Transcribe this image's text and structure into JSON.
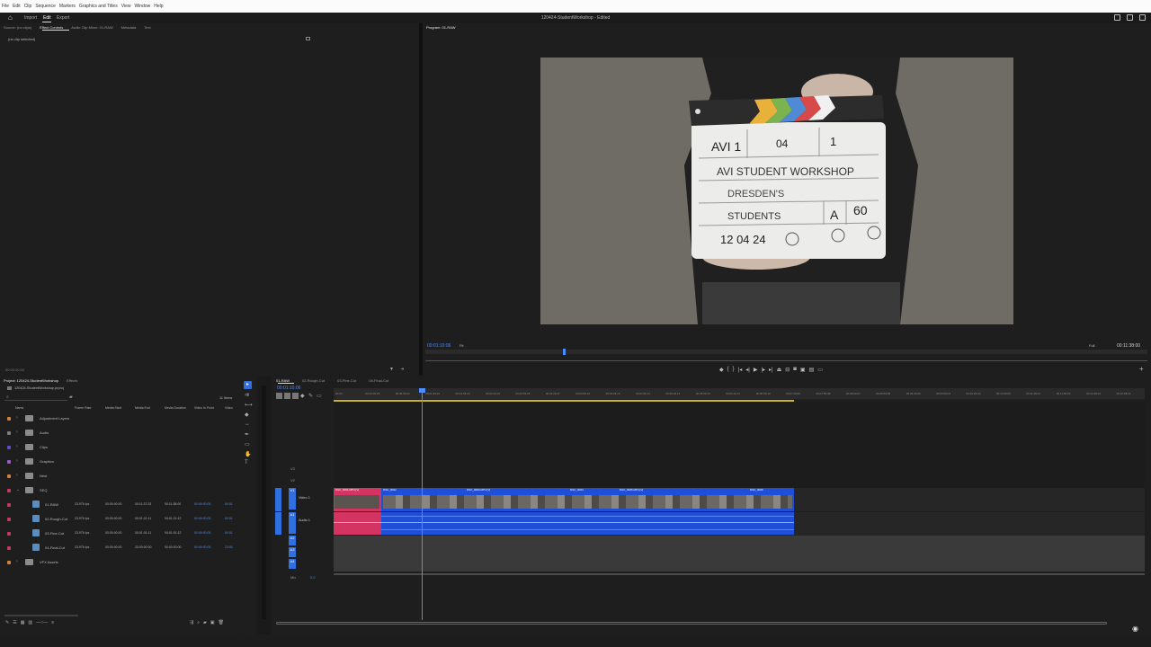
{
  "menu": [
    "File",
    "Edit",
    "Clip",
    "Sequence",
    "Markers",
    "Graphics and Titles",
    "View",
    "Window",
    "Help"
  ],
  "workspace": {
    "tabs": [
      "Import",
      "Edit",
      "Export"
    ],
    "active_tab": "Edit",
    "doc_title": "120424-StudentWorkshop - Edited"
  },
  "source_panel": {
    "tabs": [
      "Source: (no clips)",
      "Effect Controls",
      "Audio Clip Mixer: 01-RAW",
      "Metadata",
      "Text"
    ],
    "active_tab": "Effect Controls",
    "no_clip": "(no clip selected)",
    "timecode": "00:00:00:00"
  },
  "program_panel": {
    "tab": "Program: 01-RAW",
    "timecode": "00:01:10:06",
    "zoom": "Fit",
    "quality": "Full",
    "duration": "00:11:38:00"
  },
  "slate": {
    "roll": "AVI 1",
    "scene": "04",
    "take": "1",
    "production": "AVI STUDENT WORKSHOP",
    "director": "DRESDEN'S",
    "camera": "STUDENTS",
    "cam_letter": "A",
    "fps": "60",
    "date": "12 04 24"
  },
  "project_panel": {
    "tabs": [
      "Project: 120424-StudentWorkshop",
      "Effects"
    ],
    "file": "120424-StudentWorkshop.prproj",
    "item_count": "11 Items",
    "columns": [
      "Name",
      "Frame Rate",
      "Media Start",
      "Media End",
      "Media Duration",
      "Video In Point",
      "Video"
    ],
    "items": [
      {
        "name": "Adjustment Layers",
        "type": "folder",
        "color": "#d1813a",
        "expanded": false
      },
      {
        "name": "Audio",
        "type": "folder",
        "color": "#7d7d7d",
        "expanded": false
      },
      {
        "name": "Clips",
        "type": "folder",
        "color": "#5a4fd1",
        "expanded": false
      },
      {
        "name": "Graphics",
        "type": "folder",
        "color": "#9b5bc9",
        "expanded": false
      },
      {
        "name": "Nest",
        "type": "folder",
        "color": "#d1813a",
        "expanded": false
      },
      {
        "name": "SEQ",
        "type": "folder",
        "color": "#c43a5a",
        "expanded": true
      },
      {
        "name": "01-RAW",
        "type": "seq",
        "color": "#c43a5a",
        "fps": "23.976 fps",
        "start": "00:00:00:00",
        "end": "00:11:37:23",
        "dur": "00:11:38:00",
        "in": "00:00:00:00",
        "v": "00:01"
      },
      {
        "name": "02-Rough-Cut",
        "type": "seq",
        "color": "#c43a5a",
        "fps": "23.976 fps",
        "start": "00:00:00:00",
        "end": "00:01:21:11",
        "dur": "00:01:21:12",
        "in": "00:00:00:00",
        "v": "00:01"
      },
      {
        "name": "03-Fine-Cut",
        "type": "seq",
        "color": "#c43a5a",
        "fps": "23.976 fps",
        "start": "00:00:00:00",
        "end": "00:01:01:11",
        "dur": "00:01:01:12",
        "in": "00:00:00:00",
        "v": "00:01"
      },
      {
        "name": "04-Final-Cut",
        "type": "seq",
        "color": "#c43a5a",
        "fps": "23.976 fps",
        "start": "00:00:00:00",
        "end": "23:00:00:00",
        "dur": "00:00:00:00",
        "in": "00:00:00:00",
        "v": "23:00"
      },
      {
        "name": "VFX Assets",
        "type": "folder",
        "color": "#d1813a",
        "expanded": false
      }
    ]
  },
  "timeline": {
    "tabs": [
      "01-RAW",
      "02-Rough-Cut",
      "03-Fine-Cut",
      "04-Final-Cut"
    ],
    "active_tab": "01-RAW",
    "timecode": "00:01:10:06",
    "ruler": [
      "00:00",
      "00:00:29:23",
      "00:00:59:22",
      "00:01:29:21",
      "00:01:59:20",
      "00:02:29:19",
      "00:02:59:18",
      "00:03:29:17",
      "00:03:59:16",
      "00:04:29:15",
      "00:04:59:14",
      "00:05:29:13",
      "00:05:59:12",
      "00:06:29:11",
      "00:06:59:10",
      "00:07:29:09",
      "00:07:59:08",
      "00:08:29:07",
      "00:08:59:06",
      "00:09:29:05",
      "00:09:59:04",
      "00:10:29:03",
      "00:10:59:02",
      "00:11:29:01",
      "00:11:59:00",
      "00:12:28:23",
      "00:12:58:22"
    ],
    "video_tracks": [
      "V3",
      "V2",
      "V1"
    ],
    "audio_tracks": [
      "A1",
      "A2",
      "A3",
      "A4"
    ],
    "mix_label": "Mix",
    "mix_value": "0.0",
    "v1_name": "Video 1",
    "a1_name": "Audio 1",
    "clip_names": [
      "DSC_0001.MP4 [V]",
      "DSC_0002",
      "DSC_0003.MP4 [V]",
      "DSC_0004",
      "DSC_0005.MP4 [V]",
      "DSC_0006"
    ]
  },
  "colors": {
    "accent": "#4c8cff",
    "clip_blue": "#1e4fd6",
    "clip_red": "#d43462",
    "playhead": "#4c8cff"
  }
}
